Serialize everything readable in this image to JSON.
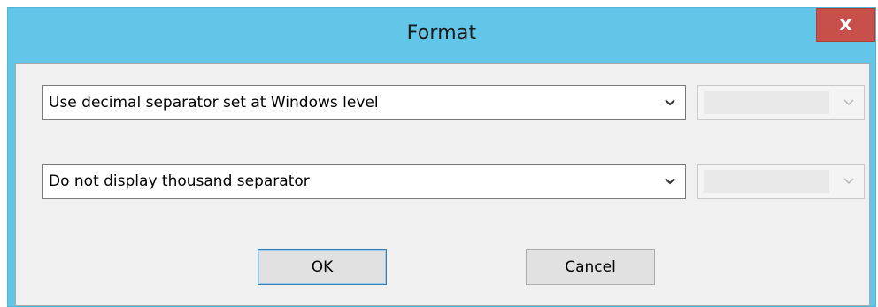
{
  "window": {
    "title": "Format",
    "close_label": "x"
  },
  "decimal_separator": {
    "selected": "Use decimal separator set at Windows level",
    "secondary_selected": ""
  },
  "thousand_separator": {
    "selected": "Do not display thousand separator",
    "secondary_selected": ""
  },
  "buttons": {
    "ok_label": "OK",
    "cancel_label": "Cancel"
  },
  "icons": {
    "close": "close-icon",
    "dropdown": "chevron-down-icon"
  },
  "colors": {
    "titlebar": "#62c6e8",
    "close_button": "#c7504a",
    "client_background": "#f0f0f0"
  }
}
